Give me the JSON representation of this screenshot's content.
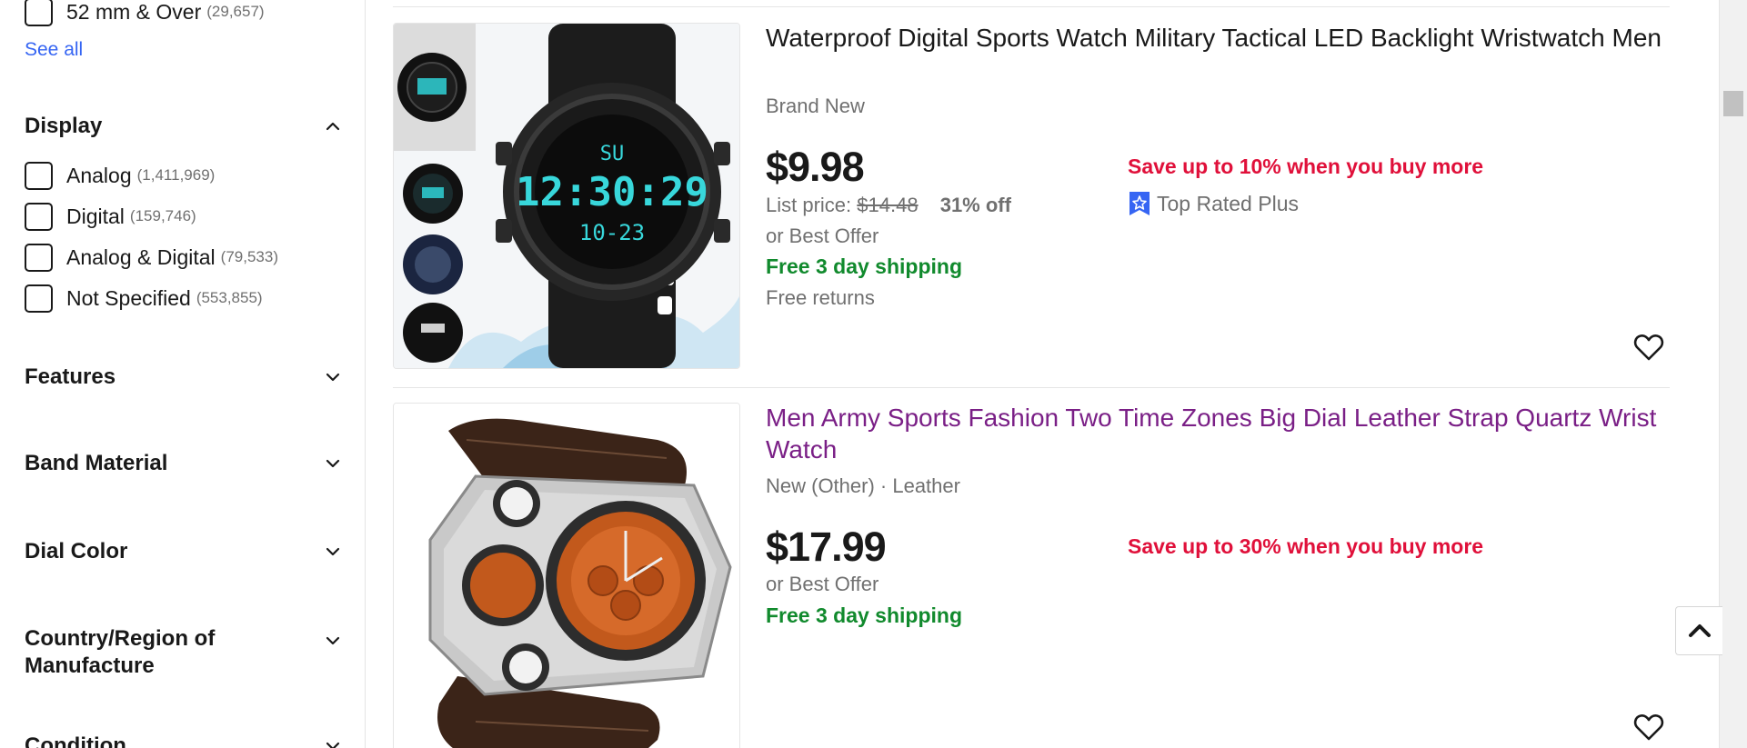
{
  "sidebar": {
    "case_size_option": {
      "label": "52 mm & Over",
      "count": "(29,657)"
    },
    "see_all": "See all",
    "display": {
      "title": "Display",
      "options": [
        {
          "label": "Analog",
          "count": "(1,411,969)"
        },
        {
          "label": "Digital",
          "count": "(159,746)"
        },
        {
          "label": "Analog & Digital",
          "count": "(79,533)"
        },
        {
          "label": "Not Specified",
          "count": "(553,855)"
        }
      ]
    },
    "facets": [
      "Features",
      "Band Material",
      "Dial Color",
      "Country/Region of Manufacture",
      "Condition"
    ]
  },
  "listings": [
    {
      "title": "Waterproof Digital Sports Watch Military Tactical LED Backlight Wristwatch Men",
      "condition": "Brand New",
      "price": "$9.98",
      "list_price_label": "List price:",
      "list_price": "$14.48",
      "discount": "31% off",
      "best_offer": "or Best Offer",
      "shipping": "Free 3 day shipping",
      "returns": "Free returns",
      "promo": "Save up to 10% when you buy more",
      "badge": "Top Rated Plus",
      "watch_display": {
        "top": "SU",
        "time": "12:30:29",
        "date": "10-23"
      }
    },
    {
      "title": "Men Army Sports Fashion Two Time Zones Big Dial Leather Strap Quartz Wrist Watch",
      "condition": "New (Other) · Leather",
      "price": "$17.99",
      "best_offer": "or Best Offer",
      "shipping": "Free 3 day shipping",
      "promo": "Save up to 30% when you buy more"
    }
  ],
  "icons": {
    "chevron_up": "chevron-up-icon",
    "chevron_down": "chevron-down-icon",
    "heart": "heart-icon",
    "back_to_top": "chevron-up-icon",
    "top_rated": "star-badge-icon"
  },
  "colors": {
    "link": "#3665f3",
    "visited_title": "#7a1f86",
    "promo_red": "#e0103a",
    "shipping_green": "#118a2d",
    "muted_gray": "#707070"
  }
}
